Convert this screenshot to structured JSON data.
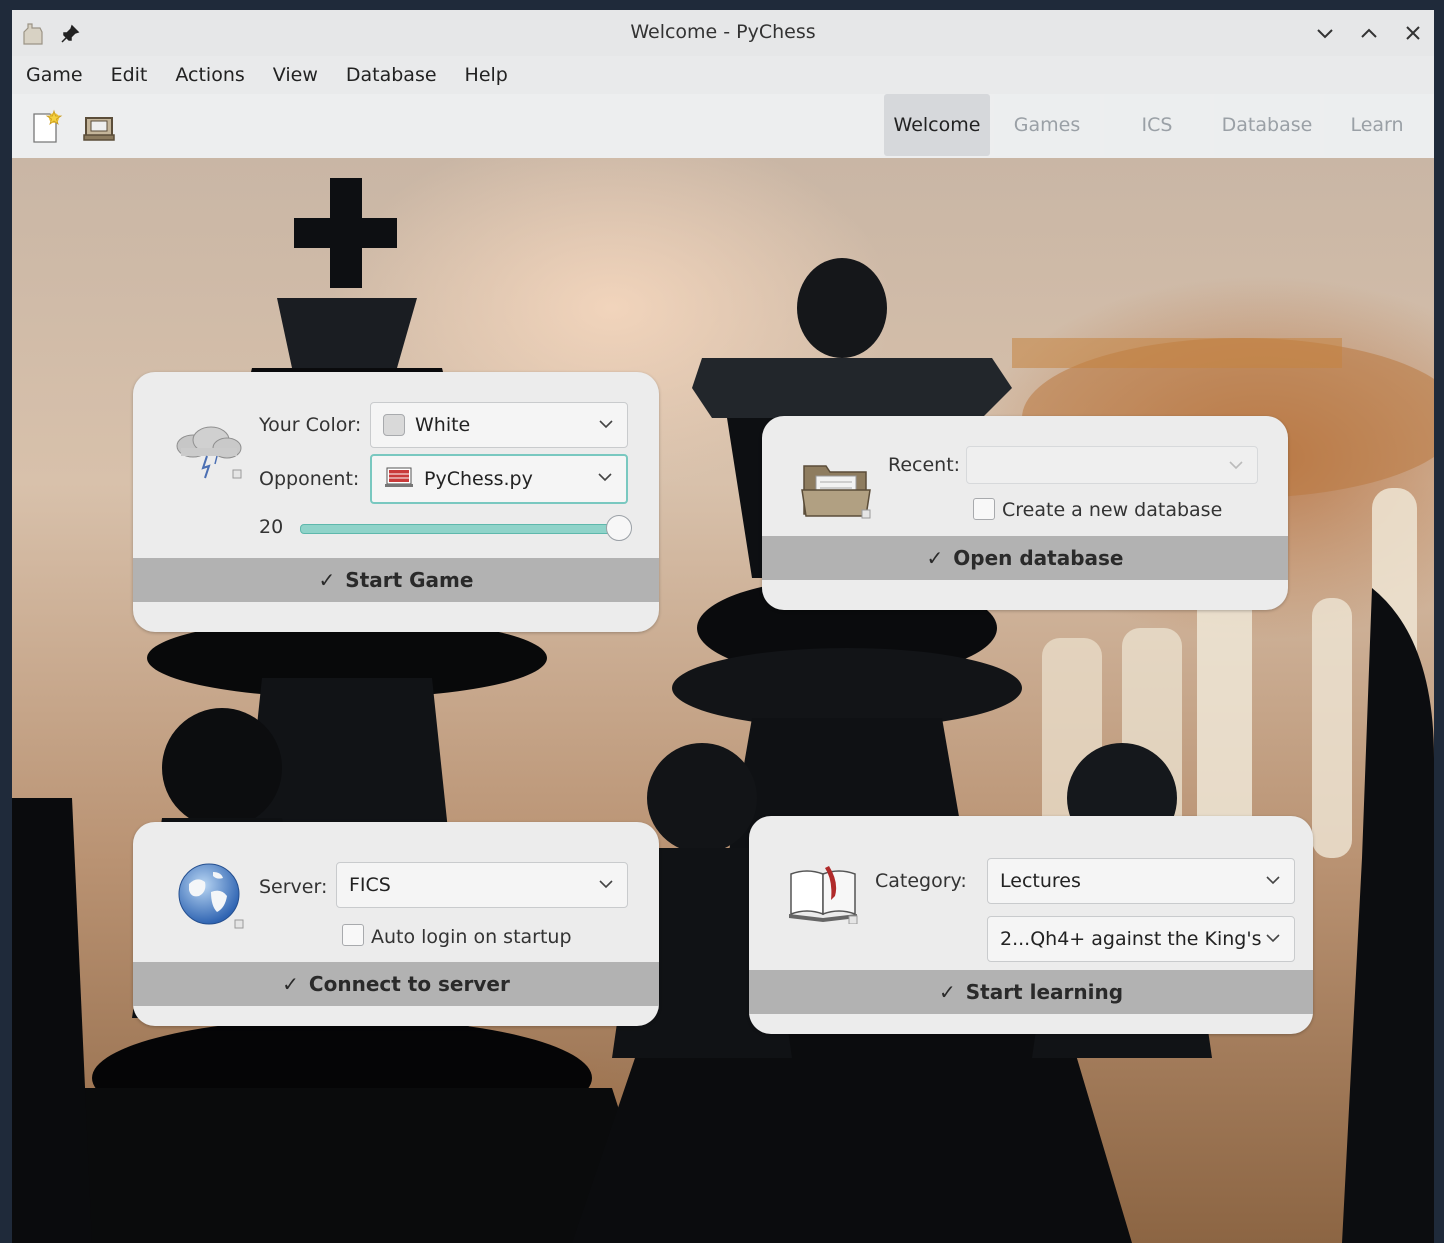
{
  "window": {
    "title": "Welcome - PyChess"
  },
  "titlebar": {
    "left_icons": [
      "app-icon",
      "pin-icon"
    ],
    "right_icons": [
      "minimize-icon",
      "maximize-icon",
      "close-icon"
    ],
    "minimize_glyph": "⌄",
    "maximize_glyph": "⌃",
    "close_glyph": "✕"
  },
  "menu": {
    "items": [
      "Game",
      "Edit",
      "Actions",
      "View",
      "Database",
      "Help"
    ]
  },
  "toolbar": {
    "icons": [
      "new-game-icon",
      "open-database-icon"
    ],
    "tabs": [
      {
        "label": "Welcome",
        "active": true
      },
      {
        "label": "Games",
        "active": false
      },
      {
        "label": "ICS",
        "active": false
      },
      {
        "label": "Database",
        "active": false
      },
      {
        "label": "Learn",
        "active": false
      }
    ]
  },
  "new_game": {
    "color_label": "Your Color:",
    "color_value": "White",
    "opponent_label": "Opponent:",
    "opponent_value": "PyChess.py",
    "level": "20",
    "level_fraction": 1.0,
    "action_label": "Start Game",
    "tick": "✓"
  },
  "database": {
    "recent_label": "Recent:",
    "recent_value": "",
    "create_label": "Create a new database",
    "action_label": "Open database",
    "tick": "✓"
  },
  "server": {
    "server_label": "Server:",
    "server_value": "FICS",
    "autologin_label": "Auto login on startup",
    "action_label": "Connect to server",
    "tick": "✓"
  },
  "learn": {
    "category_label": "Category:",
    "category_value": "Lectures",
    "lesson_value": "2...Qh4+ against the King's ...",
    "action_label": "Start learning",
    "tick": "✓"
  },
  "colors": {
    "accent": "#3daee9",
    "slider": "#8fd3c9",
    "action_bar": "#b2b2b2",
    "card": "#ececec"
  }
}
